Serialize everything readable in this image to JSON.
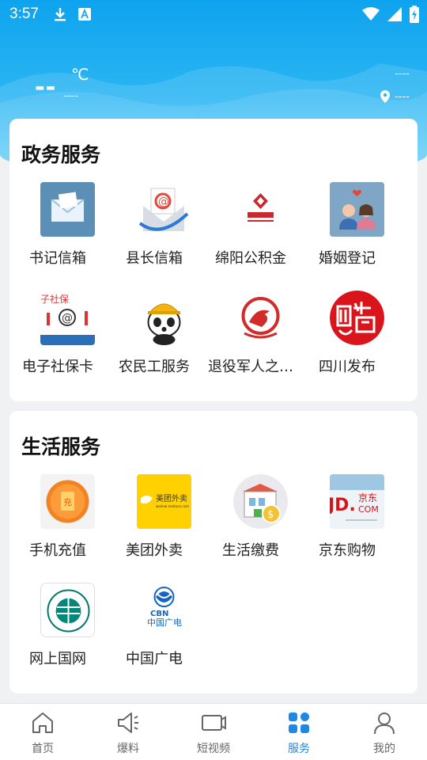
{
  "status_bar": {
    "time": "3:57"
  },
  "weather": {
    "temperature": "--",
    "unit": "℃",
    "description": "----",
    "right_top": "----",
    "location": "----"
  },
  "gov_services": {
    "title": "政务服务",
    "items": [
      {
        "label": "书记信箱",
        "icon": "envelope-icon"
      },
      {
        "label": "县长信箱",
        "icon": "email-at-icon"
      },
      {
        "label": "绵阳公积金",
        "icon": "housing-fund-logo-icon"
      },
      {
        "label": "婚姻登记",
        "icon": "couple-icon"
      },
      {
        "label": "电子社保卡",
        "icon": "social-security-icon"
      },
      {
        "label": "农民工服务",
        "icon": "panda-worker-icon"
      },
      {
        "label": "退役军人之…",
        "icon": "veteran-icon"
      },
      {
        "label": "四川发布",
        "icon": "sichuan-release-icon"
      }
    ]
  },
  "life_services": {
    "title": "生活服务",
    "items": [
      {
        "label": "手机充值",
        "icon": "recharge-icon"
      },
      {
        "label": "美团外卖",
        "icon": "meituan-icon"
      },
      {
        "label": "生活缴费",
        "icon": "bill-payment-icon"
      },
      {
        "label": "京东购物",
        "icon": "jd-shopping-icon"
      },
      {
        "label": "网上国网",
        "icon": "state-grid-icon"
      },
      {
        "label": "中国广电",
        "icon": "cbn-icon"
      }
    ]
  },
  "tabs": [
    {
      "label": "首页",
      "icon": "home-icon"
    },
    {
      "label": "爆料",
      "icon": "megaphone-icon"
    },
    {
      "label": "短视频",
      "icon": "video-icon"
    },
    {
      "label": "服务",
      "icon": "services-icon",
      "active": true
    },
    {
      "label": "我的",
      "icon": "profile-icon"
    }
  ],
  "colors": {
    "accent": "#1e88e5",
    "header": "#1aa9f0"
  }
}
